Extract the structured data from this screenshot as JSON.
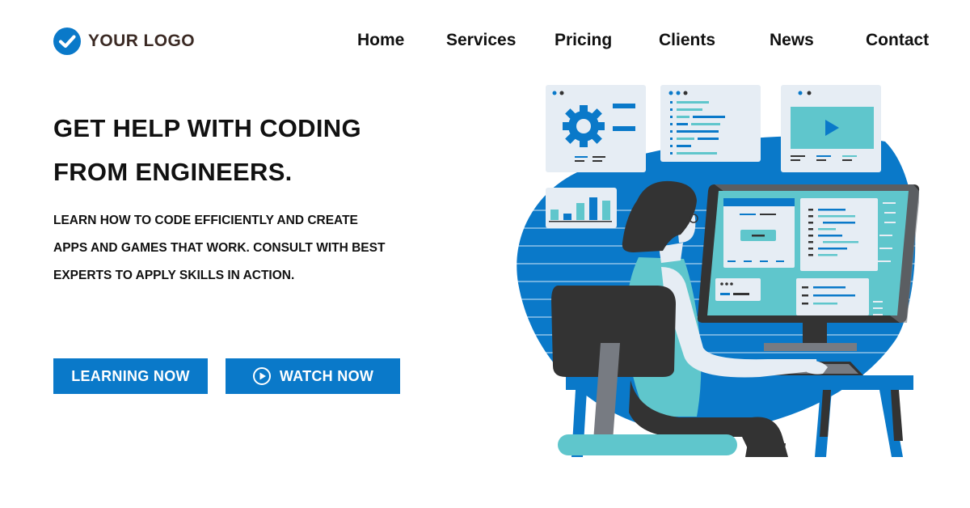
{
  "brand": {
    "name": "YOUR LOGO",
    "logo_icon": "check-circle-icon"
  },
  "nav": {
    "items": [
      {
        "label": "Home"
      },
      {
        "label": "Services"
      },
      {
        "label": "Pricing"
      },
      {
        "label": "Clients"
      },
      {
        "label": "News"
      },
      {
        "label": "Contact"
      }
    ]
  },
  "hero": {
    "headline_line1": "GET HELP WITH CODING",
    "headline_line2": "FROM ENGINEERS.",
    "subtext_line1": "LEARN HOW TO CODE EFFICIENTLY AND CREATE",
    "subtext_line2": "APPS AND GAMES THAT WORK. CONSULT WITH BEST",
    "subtext_line3": "EXPERTS TO APPLY SKILLS IN ACTION.",
    "primary_button": "LEARNING NOW",
    "secondary_button": "WATCH NOW",
    "secondary_button_icon": "play-circle-icon"
  },
  "colors": {
    "accent": "#0a79c9",
    "teal": "#5fc6cc",
    "dark": "#333333",
    "panel": "#e6edf4",
    "logo_text": "#3b2a24"
  }
}
